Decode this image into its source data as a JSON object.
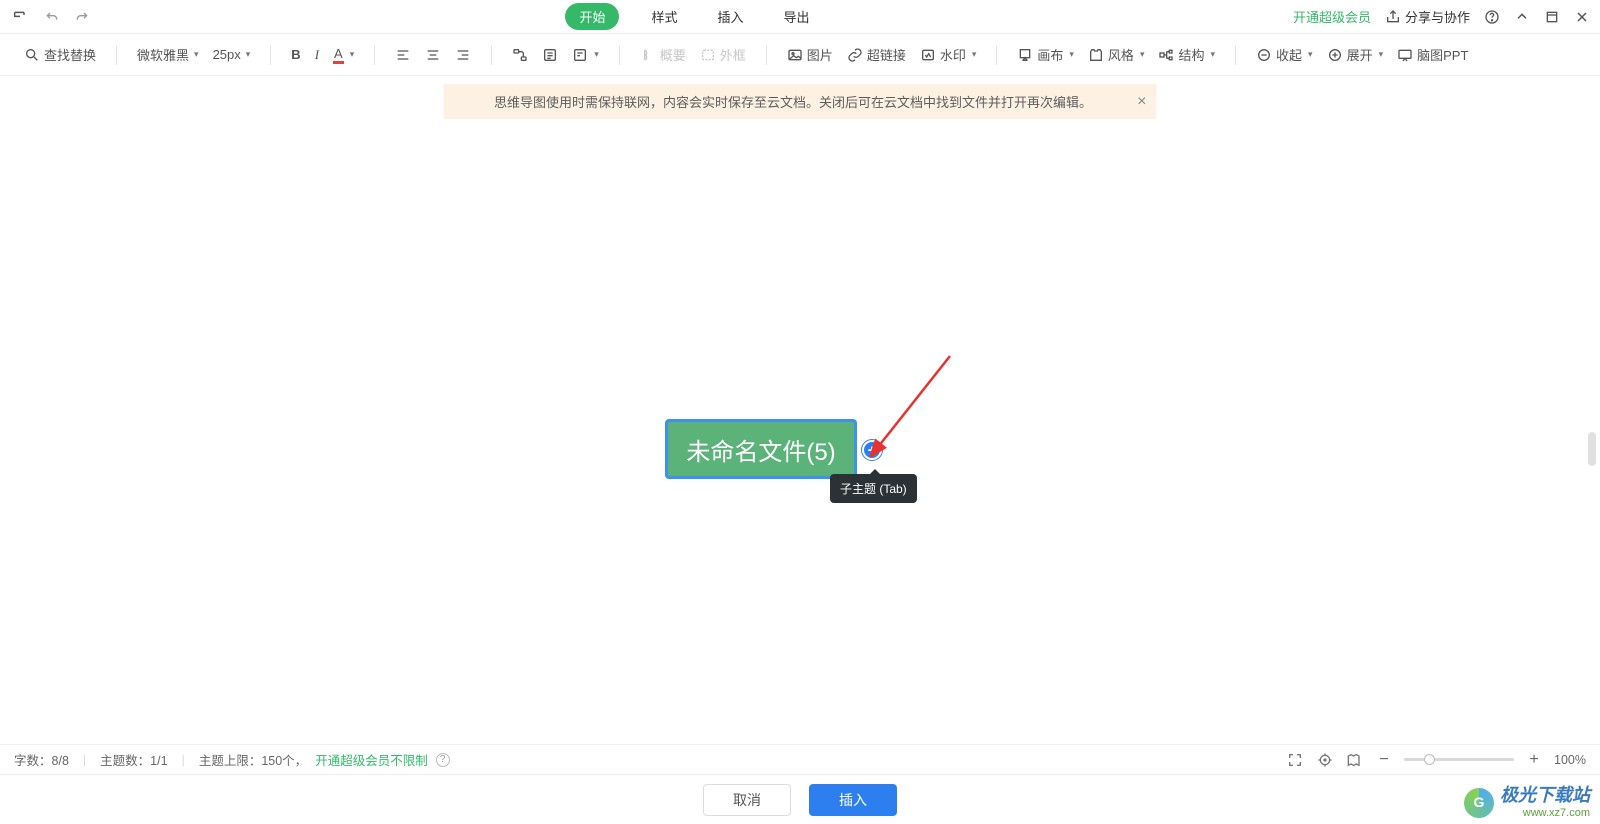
{
  "menubar": {
    "tabs": {
      "start": "开始",
      "style": "样式",
      "insert": "插入",
      "export": "导出"
    },
    "vip": "开通超级会员",
    "share": "分享与协作"
  },
  "toolbar": {
    "findReplace": "查找替换",
    "fontName": "微软雅黑",
    "fontSize": "25px",
    "summary": "概要",
    "frame": "外框",
    "image": "图片",
    "link": "超链接",
    "watermark": "水印",
    "canvas": "画布",
    "theme": "风格",
    "structure": "结构",
    "collapse": "收起",
    "expand": "展开",
    "ppt": "脑图PPT"
  },
  "banner": {
    "text": "思维导图使用时需保持联网，内容会实时保存至云文档。关闭后可在云文档中找到文件并打开再次编辑。"
  },
  "node": {
    "title": "未命名文件(5)"
  },
  "tooltip": {
    "text": "子主题 (Tab)"
  },
  "status": {
    "wordCountLabel": "字数：",
    "wordCount": "8/8",
    "topicCountLabel": "主题数：",
    "topicCount": "1/1",
    "topicLimitLabel": "主题上限：",
    "topicLimit": "150个，",
    "vipUnlimited": "开通超级会员不限制",
    "zoom": "100%"
  },
  "actions": {
    "cancel": "取消",
    "insert": "插入"
  },
  "watermark": {
    "line1": "极光下载站",
    "line2": "www.xz7.com"
  }
}
